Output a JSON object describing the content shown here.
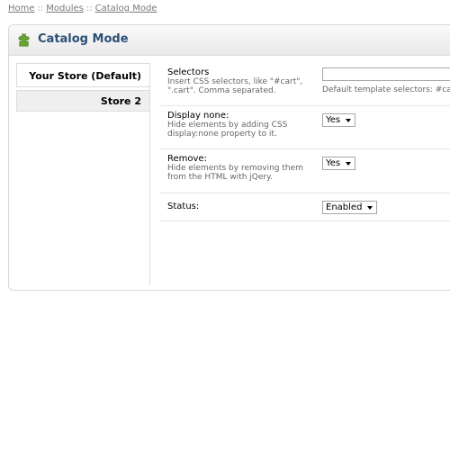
{
  "breadcrumb": {
    "items": [
      "Home",
      "Modules",
      "Catalog Mode"
    ],
    "separator": "::"
  },
  "panel": {
    "title": "Catalog Mode",
    "icon": "puzzle-plugin-icon",
    "title_color": "#2b4f78",
    "icon_color": "#6aa531"
  },
  "tabs": [
    {
      "label": "Your Store (Default)",
      "active": true
    },
    {
      "label": "Store 2",
      "active": false
    }
  ],
  "form": {
    "selectors": {
      "label": "Selectors",
      "help": "Insert CSS selectors, like \"#cart\", \".cart\". Comma separated.",
      "value": "",
      "hint": "Default template selectors: #cart"
    },
    "display_none": {
      "label": "Display none:",
      "help": "Hide elements by adding CSS display:none property to it.",
      "value": "Yes"
    },
    "remove": {
      "label": "Remove:",
      "help": "Hide elements by removing them from the HTML with jQery.",
      "value": "Yes"
    },
    "status": {
      "label": "Status:",
      "value": "Enabled"
    }
  }
}
